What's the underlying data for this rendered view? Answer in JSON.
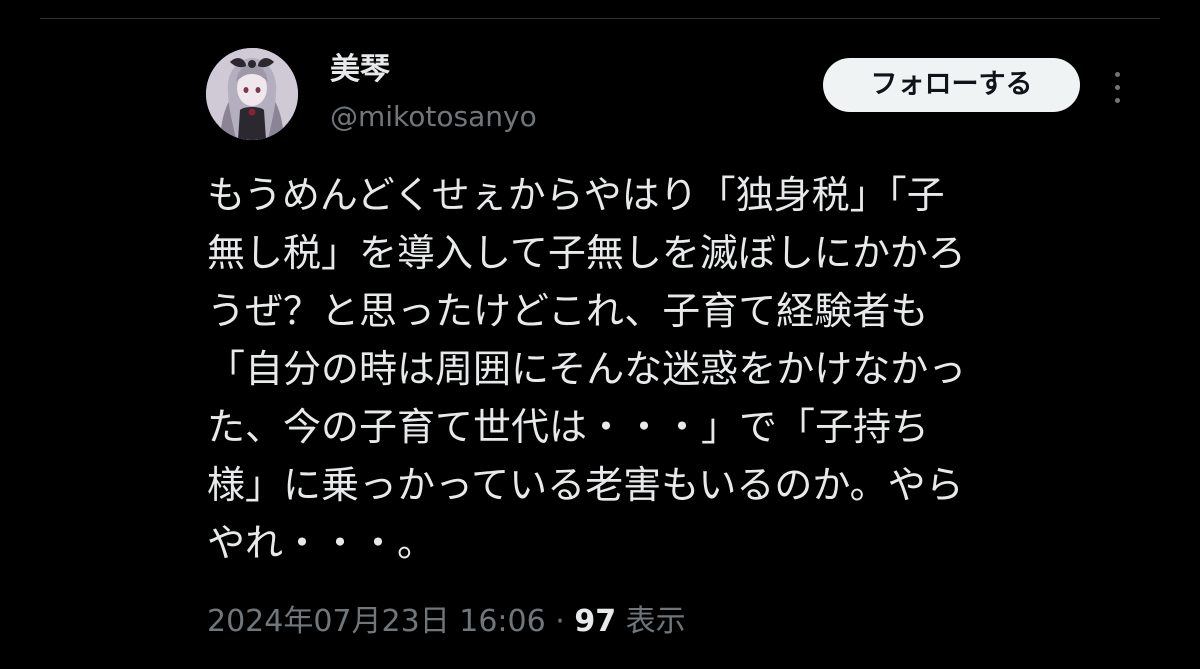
{
  "tweet": {
    "author": {
      "display_name": "美琴",
      "handle": "@mikotosanyo",
      "avatar_icon": "avatar-icon"
    },
    "follow_label": "フォローする",
    "more_icon": "more-dots-icon",
    "text": "もうめんどくせぇからやはり「独身税」「子\n無し税」を導入して子無しを滅ぼしにかかろ\nうぜ？と思ったけどこれ、子育て経験者も\n「自分の時は周囲にそんな迷惑をかけなかっ\nた、今の子育て世代は・・・」で「子持ち\n様」に乗っかっている老害もいるのか。やら\nやれ・・・。",
    "timestamp": "2024年07月23日 16:06",
    "separator": "·",
    "views_count": "97",
    "views_label": "表示"
  },
  "colors": {
    "background": "#000000",
    "primary_text": "#e7e9ea",
    "secondary_text": "#71767b",
    "follow_button_bg": "#eff3f4",
    "follow_button_text": "#0f1419"
  }
}
